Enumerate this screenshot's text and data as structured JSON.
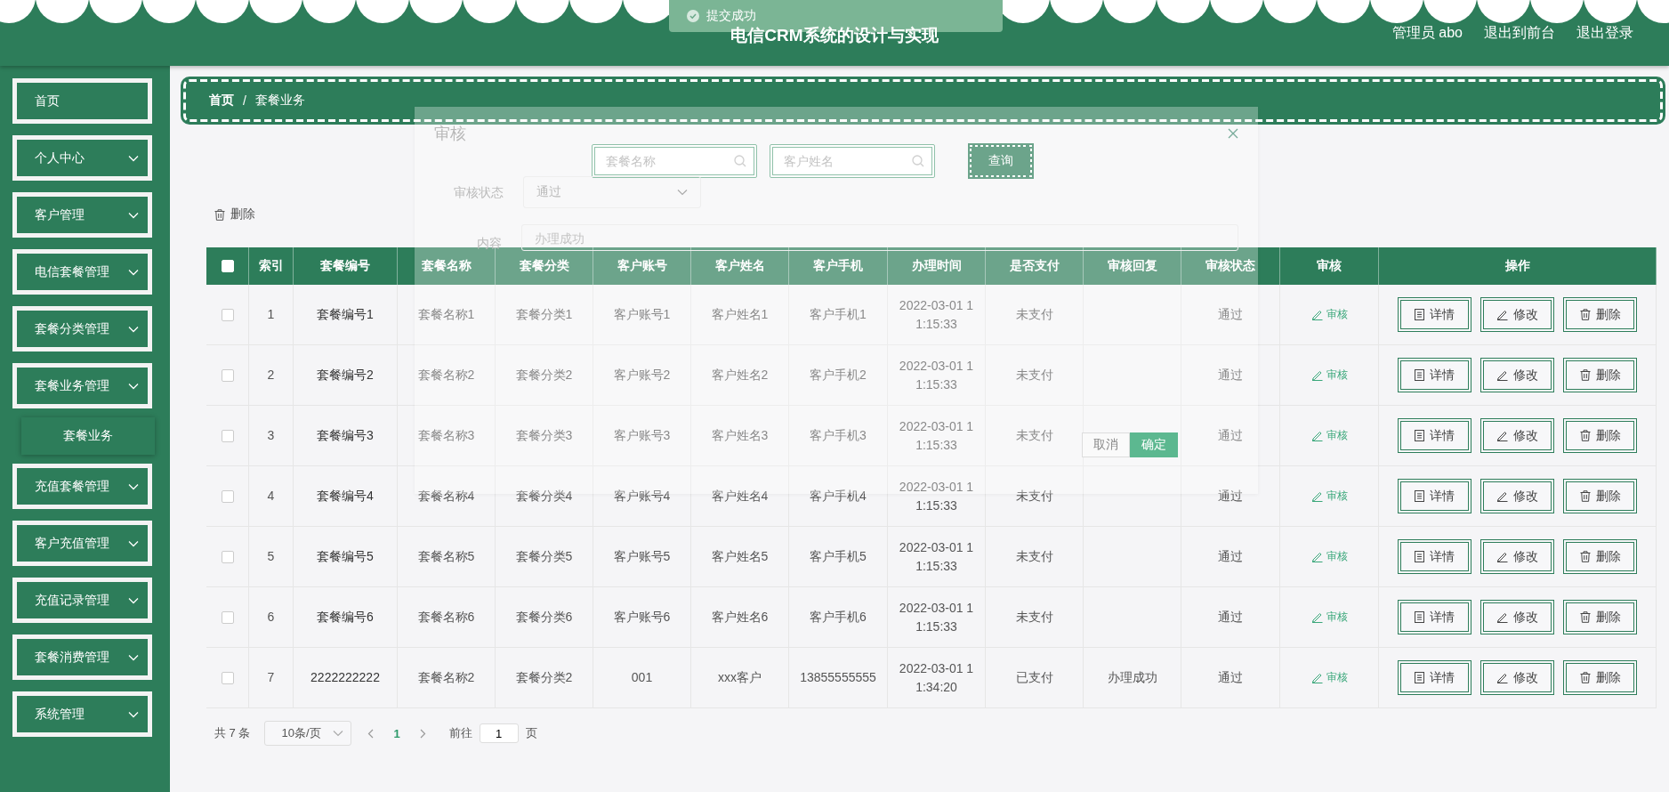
{
  "header": {
    "title": "电信CRM系统的设计与实现",
    "user": "管理员 abo",
    "links": [
      "退出到前台",
      "退出登录"
    ]
  },
  "toast": {
    "text": "提交成功"
  },
  "sidebar": {
    "items": [
      {
        "label": "首页",
        "kind": "link"
      },
      {
        "label": "个人中心",
        "kind": "menu"
      },
      {
        "label": "客户管理",
        "kind": "menu"
      },
      {
        "label": "电信套餐管理",
        "kind": "menu"
      },
      {
        "label": "套餐分类管理",
        "kind": "menu"
      },
      {
        "label": "套餐业务管理",
        "kind": "menu",
        "children": [
          {
            "label": "套餐业务",
            "selected": true
          }
        ]
      },
      {
        "label": "充值套餐管理",
        "kind": "menu"
      },
      {
        "label": "客户充值管理",
        "kind": "menu"
      },
      {
        "label": "充值记录管理",
        "kind": "menu"
      },
      {
        "label": "套餐消费管理",
        "kind": "menu"
      },
      {
        "label": "系统管理",
        "kind": "menu"
      }
    ]
  },
  "breadcrumb": {
    "items": [
      "首页",
      "套餐业务"
    ],
    "separator": "/"
  },
  "search": {
    "fields": [
      {
        "placeholder": "套餐名称"
      },
      {
        "placeholder": "客户姓名"
      }
    ],
    "button": "查询"
  },
  "toolbar": {
    "delete_button": "删除"
  },
  "table": {
    "header_checked": false,
    "columns": [
      "索引",
      "套餐编号",
      "套餐名称",
      "套餐分类",
      "客户账号",
      "客户姓名",
      "客户手机",
      "办理时间",
      "是否支付",
      "审核回复",
      "审核状态",
      "审核",
      "操作"
    ],
    "rows": [
      {
        "checked": false,
        "cells": [
          "1",
          "套餐编号1",
          "套餐名称1",
          "套餐分类1",
          "客户账号1",
          "客户姓名1",
          "客户手机1",
          "2022-03-01 11:15:33",
          "未支付",
          "",
          "通过"
        ],
        "review": "审核",
        "actions": [
          "详情",
          "修改",
          "删除"
        ]
      },
      {
        "checked": false,
        "cells": [
          "2",
          "套餐编号2",
          "套餐名称2",
          "套餐分类2",
          "客户账号2",
          "客户姓名2",
          "客户手机2",
          "2022-03-01 11:15:33",
          "未支付",
          "",
          "通过"
        ],
        "review": "审核",
        "actions": [
          "详情",
          "修改",
          "删除"
        ]
      },
      {
        "checked": false,
        "cells": [
          "3",
          "套餐编号3",
          "套餐名称3",
          "套餐分类3",
          "客户账号3",
          "客户姓名3",
          "客户手机3",
          "2022-03-01 11:15:33",
          "未支付",
          "",
          "通过"
        ],
        "review": "审核",
        "actions": [
          "详情",
          "修改",
          "删除"
        ]
      },
      {
        "checked": false,
        "cells": [
          "4",
          "套餐编号4",
          "套餐名称4",
          "套餐分类4",
          "客户账号4",
          "客户姓名4",
          "客户手机4",
          "2022-03-01 11:15:33",
          "未支付",
          "",
          "通过"
        ],
        "review": "审核",
        "actions": [
          "详情",
          "修改",
          "删除"
        ]
      },
      {
        "checked": false,
        "cells": [
          "5",
          "套餐编号5",
          "套餐名称5",
          "套餐分类5",
          "客户账号5",
          "客户姓名5",
          "客户手机5",
          "2022-03-01 11:15:33",
          "未支付",
          "",
          "通过"
        ],
        "review": "审核",
        "actions": [
          "详情",
          "修改",
          "删除"
        ]
      },
      {
        "checked": false,
        "cells": [
          "6",
          "套餐编号6",
          "套餐名称6",
          "套餐分类6",
          "客户账号6",
          "客户姓名6",
          "客户手机6",
          "2022-03-01 11:15:33",
          "未支付",
          "",
          "通过"
        ],
        "review": "审核",
        "actions": [
          "详情",
          "修改",
          "删除"
        ]
      },
      {
        "checked": false,
        "cells": [
          "7",
          "2222222222",
          "套餐名称2",
          "套餐分类2",
          "001",
          "xxx客户",
          "13855555555",
          "2022-03-01 11:34:20",
          "已支付",
          "办理成功",
          "通过"
        ],
        "review": "审核",
        "actions": [
          "详情",
          "修改",
          "删除"
        ]
      }
    ]
  },
  "pagination": {
    "total": "共 7 条",
    "page_size": "10条/页",
    "pages": [
      {
        "label": "1",
        "selected": true
      }
    ],
    "goto_label": "前往",
    "goto_value": "1",
    "goto_suffix": "页"
  },
  "dialog": {
    "title": "审核",
    "fields": [
      {
        "label": "审核状态",
        "kind": "select",
        "value": "通过"
      },
      {
        "label": "内容",
        "kind": "textarea",
        "value": "办理成功"
      }
    ],
    "buttons": [
      "取消",
      "确定"
    ]
  }
}
